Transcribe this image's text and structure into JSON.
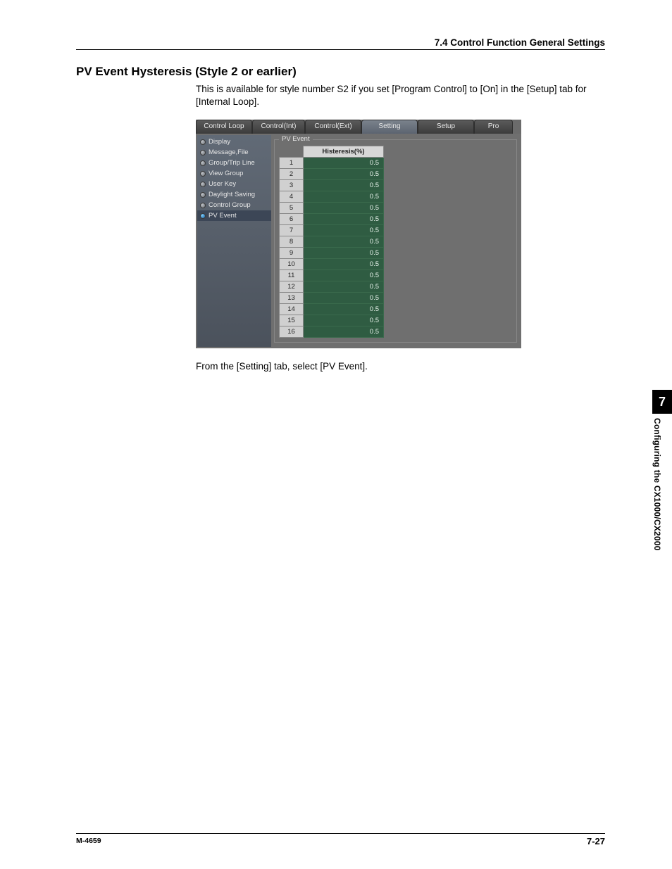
{
  "header": {
    "section": "7.4  Control Function General Settings"
  },
  "title": "PV Event Hysteresis (Style 2 or earlier)",
  "intro": "This is available for style number S2 if you set [Program Control] to [On] in the [Setup] tab for [Internal Loop].",
  "app": {
    "tabs": [
      "Control Loop",
      "Control(Int)",
      "Control(Ext)",
      "Setting",
      "Setup",
      "Pro"
    ],
    "active_tab": 3,
    "side_items": [
      "Display",
      "Message,File",
      "Group/Trip Line",
      "View Group",
      "User Key",
      "Daylight Saving",
      "Control Group",
      "PV Event"
    ],
    "side_selected": 7,
    "group_title": "PV Event",
    "col_header": "Histeresis(%)",
    "rows": [
      {
        "n": "1",
        "v": "0.5"
      },
      {
        "n": "2",
        "v": "0.5"
      },
      {
        "n": "3",
        "v": "0.5"
      },
      {
        "n": "4",
        "v": "0.5"
      },
      {
        "n": "5",
        "v": "0.5"
      },
      {
        "n": "6",
        "v": "0.5"
      },
      {
        "n": "7",
        "v": "0.5"
      },
      {
        "n": "8",
        "v": "0.5"
      },
      {
        "n": "9",
        "v": "0.5"
      },
      {
        "n": "10",
        "v": "0.5"
      },
      {
        "n": "11",
        "v": "0.5"
      },
      {
        "n": "12",
        "v": "0.5"
      },
      {
        "n": "13",
        "v": "0.5"
      },
      {
        "n": "14",
        "v": "0.5"
      },
      {
        "n": "15",
        "v": "0.5"
      },
      {
        "n": "16",
        "v": "0.5"
      }
    ]
  },
  "after": "From the [Setting] tab, select [PV Event].",
  "thumb": {
    "num": "7",
    "text": "Configuring the CX1000/CX2000"
  },
  "footer": {
    "left": "M-4659",
    "right": "7-27"
  }
}
